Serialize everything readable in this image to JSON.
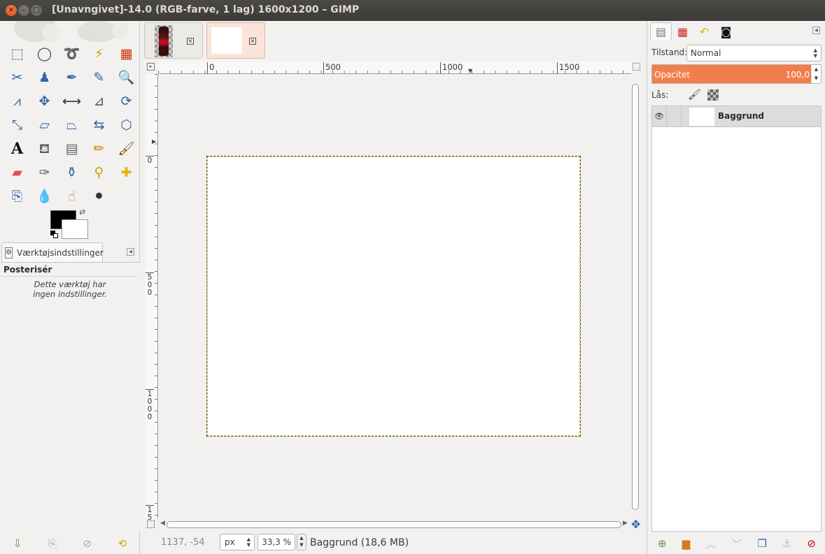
{
  "window": {
    "title": "[Unavngivet]-14.0 (RGB-farve, 1 lag) 1600x1200 – GIMP",
    "close": "×",
    "minimize": "–",
    "maximize": "□"
  },
  "toolbox": {
    "tools": [
      {
        "name": "rect-select-icon",
        "glyph": "⬚",
        "color": "#444444"
      },
      {
        "name": "ellipse-select-icon",
        "glyph": "◯",
        "color": "#444444"
      },
      {
        "name": "free-select-icon",
        "glyph": "➰",
        "color": "#444444"
      },
      {
        "name": "fuzzy-select-icon",
        "glyph": "⚡",
        "color": "#c9a400"
      },
      {
        "name": "select-by-color-icon",
        "glyph": "▦",
        "color": "#cc3300"
      },
      {
        "name": "scissors-select-icon",
        "glyph": "✂",
        "color": "#3465a4"
      },
      {
        "name": "foreground-select-icon",
        "glyph": "♟",
        "color": "#3465a4"
      },
      {
        "name": "paths-icon",
        "glyph": "✒",
        "color": "#3465a4"
      },
      {
        "name": "color-picker-icon",
        "glyph": "✎",
        "color": "#3465a4"
      },
      {
        "name": "zoom-icon",
        "glyph": "🔍",
        "color": "#3465a4"
      },
      {
        "name": "measure-icon",
        "glyph": "⩘",
        "color": "#3465a4"
      },
      {
        "name": "move-icon",
        "glyph": "✥",
        "color": "#3465a4"
      },
      {
        "name": "align-icon",
        "glyph": "⟷",
        "color": "#333333"
      },
      {
        "name": "crop-icon",
        "glyph": "⊿",
        "color": "#555555"
      },
      {
        "name": "rotate-icon",
        "glyph": "⟳",
        "color": "#3465a4"
      },
      {
        "name": "scale-icon",
        "glyph": "⤡",
        "color": "#3465a4"
      },
      {
        "name": "shear-icon",
        "glyph": "▱",
        "color": "#3465a4"
      },
      {
        "name": "perspective-icon",
        "glyph": "⏢",
        "color": "#3465a4"
      },
      {
        "name": "flip-icon",
        "glyph": "⇆",
        "color": "#3465a4"
      },
      {
        "name": "cage-transform-icon",
        "glyph": "⬡",
        "color": "#3465a4"
      },
      {
        "name": "text-icon",
        "glyph": "A",
        "color": "#111111"
      },
      {
        "name": "bucket-fill-icon",
        "glyph": "⛾",
        "color": "#555555"
      },
      {
        "name": "blend-icon",
        "glyph": "▤",
        "color": "#666666"
      },
      {
        "name": "pencil-icon",
        "glyph": "✏",
        "color": "#cc7a00"
      },
      {
        "name": "paintbrush-icon",
        "glyph": "🖌",
        "color": "#8a4a00"
      },
      {
        "name": "eraser-icon",
        "glyph": "▰",
        "color": "#e05050"
      },
      {
        "name": "airbrush-icon",
        "glyph": "✑",
        "color": "#555555"
      },
      {
        "name": "ink-icon",
        "glyph": "⚱",
        "color": "#3465a4"
      },
      {
        "name": "clone-icon",
        "glyph": "⚲",
        "color": "#c9a400"
      },
      {
        "name": "heal-icon",
        "glyph": "✚",
        "color": "#e8b400"
      },
      {
        "name": "perspective-clone-icon",
        "glyph": "⎘",
        "color": "#3465a4"
      },
      {
        "name": "blur-icon",
        "glyph": "💧",
        "color": "#3465a4"
      },
      {
        "name": "smudge-icon",
        "glyph": "☝",
        "color": "#cc7a44"
      },
      {
        "name": "dodge-burn-icon",
        "glyph": "⚫",
        "color": "#333333"
      }
    ],
    "options_tab": "Værktøjsindstillinger",
    "tool_name": "Posterisér",
    "tool_message_line1": "Dette værktøj har",
    "tool_message_line2": "ingen indstillinger.",
    "bottom_buttons": [
      "save-options-icon",
      "restore-options-icon",
      "delete-options-icon",
      "reset-options-icon"
    ]
  },
  "image": {
    "tabs": [
      "cola-image",
      "unnamed-image"
    ],
    "ruler_h_labels": [
      "0",
      "500",
      "1000",
      "1500"
    ],
    "ruler_v_labels": [
      "0",
      "5\n0\n0",
      "1\n0\n0\n0",
      "1\n5"
    ],
    "coords": "1137, -54",
    "unit": "px",
    "zoom": "33,3 %",
    "status": "Baggrund (18,6 MB)"
  },
  "layers": {
    "mode_label": "Tilstand:",
    "mode_value": "Normal",
    "opacity_label": "Opacitet",
    "opacity_value": "100,0",
    "opacity_fraction": 1.0,
    "lock_label": "Lås:",
    "layer_name": "Baggrund",
    "accent_color": "#f27f4b"
  }
}
